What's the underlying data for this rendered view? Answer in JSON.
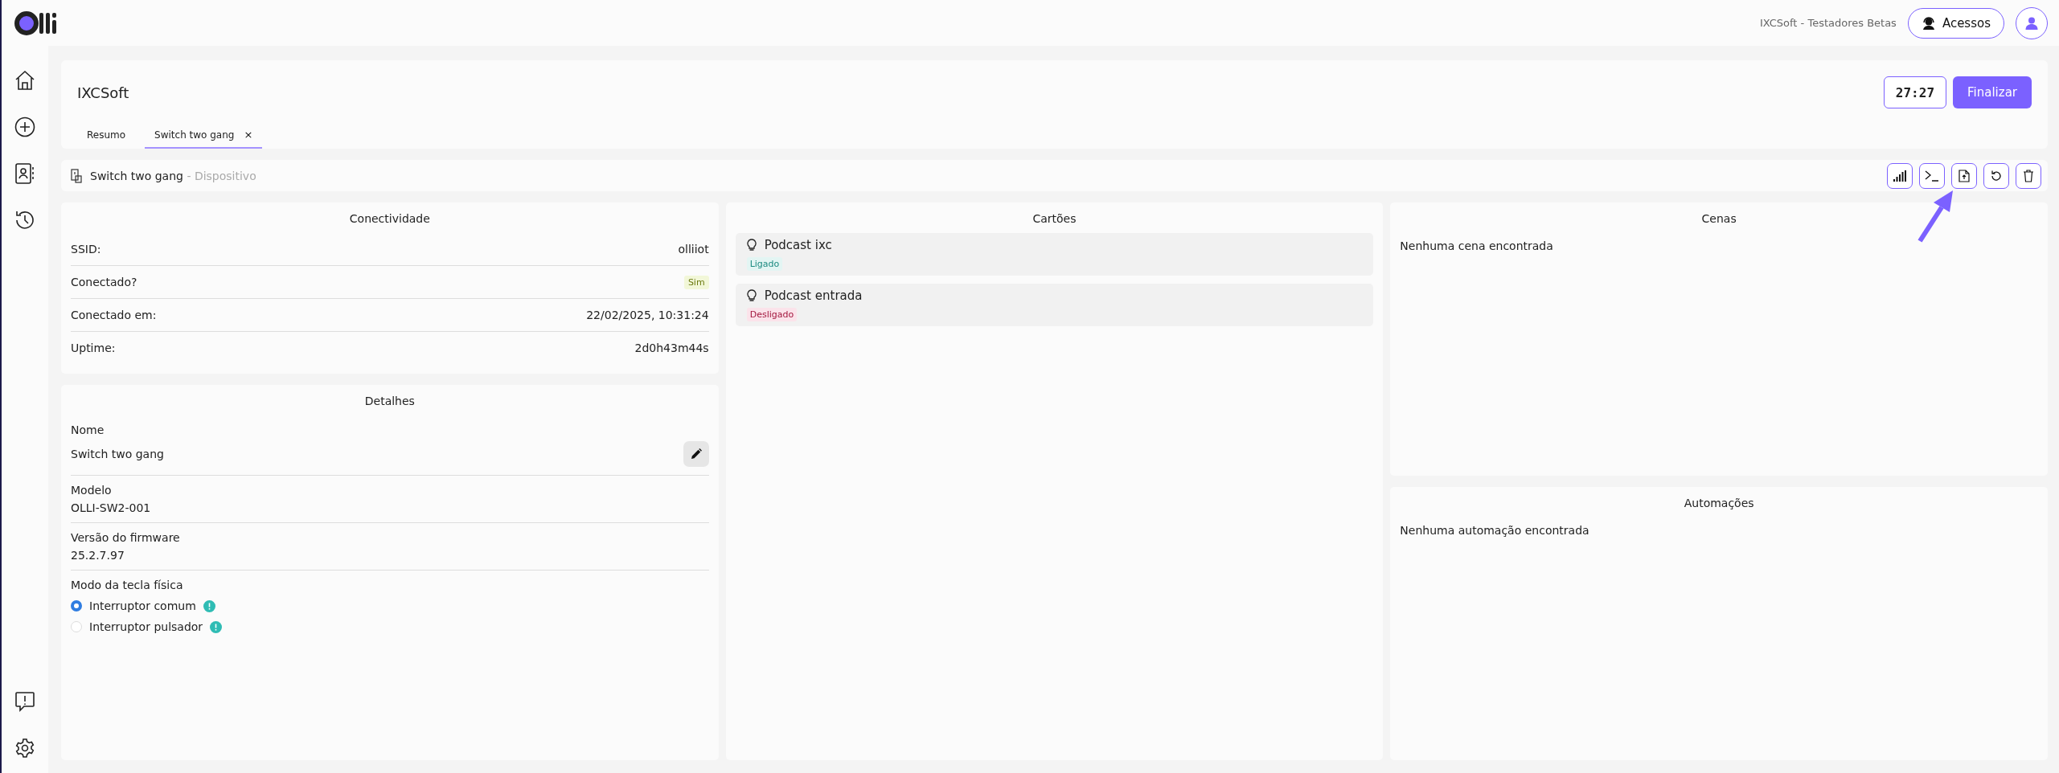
{
  "topbar": {
    "organization": "IXCSoft - Testadores Betas",
    "access_button": "Acessos"
  },
  "header": {
    "title": "IXCSoft",
    "timer": "27:27",
    "finish_button": "Finalizar",
    "tabs": [
      {
        "label": "Resumo",
        "selected": false
      },
      {
        "label": "Switch two gang",
        "selected": true,
        "close": "×"
      }
    ]
  },
  "device_bar": {
    "name": "Switch two gang",
    "suffix": "- Dispositivo"
  },
  "connectivity": {
    "title": "Conectividade",
    "rows": [
      {
        "label": "SSID:",
        "value": "olliiot",
        "kind": "text"
      },
      {
        "label": "Conectado?",
        "value": "Sim",
        "kind": "badge"
      },
      {
        "label": "Conectado em:",
        "value": "22/02/2025, 10:31:24",
        "kind": "text"
      },
      {
        "label": "Uptime:",
        "value": "2d0h43m44s",
        "kind": "text"
      }
    ]
  },
  "details": {
    "title": "Detalhes",
    "name_label": "Nome",
    "name_value": "Switch two gang",
    "model_label": "Modelo",
    "model_value": "OLLI-SW2-001",
    "firmware_label": "Versão do firmware",
    "firmware_value": "25.2.7.97",
    "mode_label": "Modo da tecla física",
    "modes": [
      {
        "label": "Interruptor comum",
        "selected": true
      },
      {
        "label": "Interruptor pulsador",
        "selected": false
      }
    ]
  },
  "cards": {
    "title": "Cartões",
    "items": [
      {
        "name": "Podcast ixc",
        "status": "Ligado",
        "on": true
      },
      {
        "name": "Podcast entrada",
        "status": "Desligado",
        "on": false
      }
    ]
  },
  "scenes": {
    "title": "Cenas",
    "empty": "Nenhuma cena encontrada"
  },
  "automations": {
    "title": "Automações",
    "empty": "Nenhuma automação encontrada"
  }
}
